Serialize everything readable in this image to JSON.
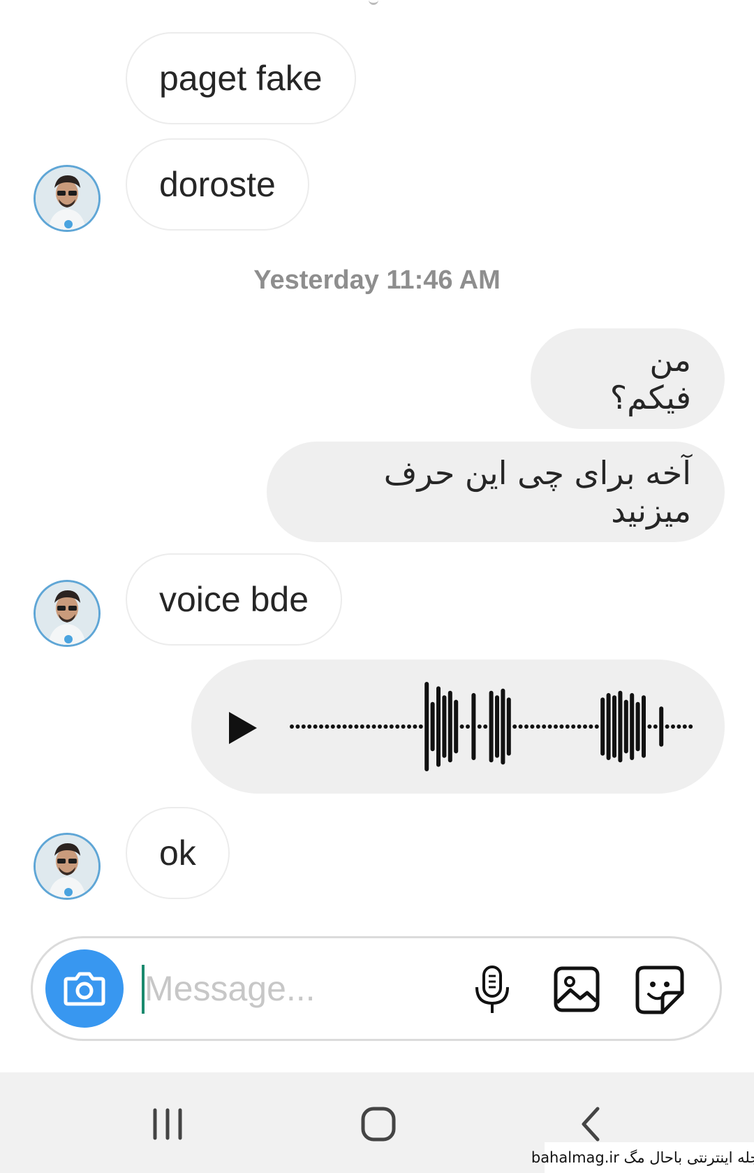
{
  "messages": {
    "m1": "paget fake",
    "m2": "doroste",
    "timestamp": "Yesterday 11:46 AM",
    "m3": "من فیکم؟",
    "m4": "آخه برای چی این حرف میزنید",
    "m5": "voice bde",
    "m7": "ok"
  },
  "voice_message": {
    "play_icon": "play-icon",
    "waveform": [
      0,
      0,
      0,
      0,
      0,
      0,
      0,
      0,
      0,
      0,
      0,
      0,
      0,
      0,
      0,
      0,
      0,
      0,
      0,
      0,
      0,
      0,
      0,
      1,
      0.55,
      0.9,
      0.7,
      0.8,
      0.6,
      0,
      0,
      0.75,
      0,
      0,
      0.8,
      0.7,
      0.85,
      0.65,
      0,
      0,
      0,
      0,
      0,
      0,
      0,
      0,
      0,
      0,
      0,
      0,
      0,
      0,
      0,
      0.65,
      0.75,
      0.7,
      0.8,
      0.6,
      0.75,
      0.55,
      0.7,
      0,
      0,
      0.45,
      0,
      0,
      0,
      0,
      0
    ]
  },
  "composer": {
    "placeholder": "Message...",
    "camera_icon": "camera-icon",
    "mic_icon": "microphone-icon",
    "gallery_icon": "gallery-icon",
    "sticker_icon": "sticker-icon"
  },
  "nav_bar": {
    "recents_icon": "recents-icon",
    "home_icon": "home-icon",
    "back_icon": "back-icon"
  },
  "watermark": "bahalmag.ir مجله اینترنتی باحال مگ",
  "colors": {
    "accent": "#3897f0",
    "outgoing_bubble": "#efefef",
    "timestamp": "#8e8e8e",
    "cursor": "#1a8a6e"
  }
}
